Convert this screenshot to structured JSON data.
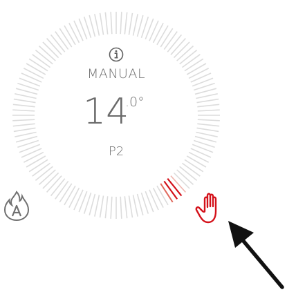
{
  "thermostat": {
    "mode": "MANUAL",
    "temperature_whole": "14",
    "temperature_decimal": ".0°",
    "program": "P2",
    "setpoint_ticks_highlighted": 4
  },
  "icons": {
    "info": "info-icon",
    "auto_flame": "auto-flame-icon",
    "manual_hand": "hand-icon",
    "pointer_arrow": "arrow-icon"
  },
  "colors": {
    "tick_default": "#dcdcdc",
    "tick_highlight_light": "#efb7b0",
    "tick_highlight_mid": "#e0685c",
    "tick_highlight_strong": "#d4111a",
    "text": "#6e6e6e",
    "hand_active": "#d4111a",
    "flame_icon": "#707070",
    "arrow": "#111111"
  }
}
